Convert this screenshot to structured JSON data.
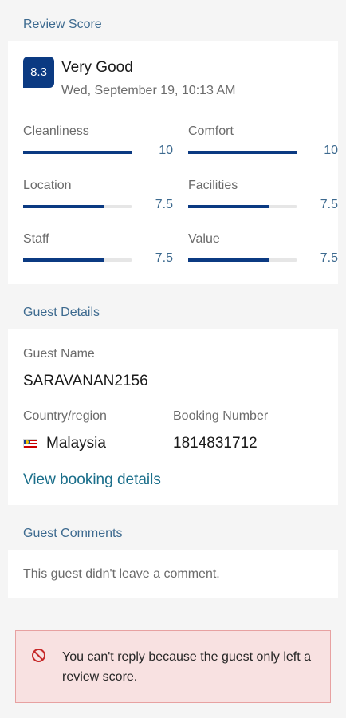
{
  "review_score": {
    "section_title": "Review Score",
    "score": "8.3",
    "rating_label": "Very Good",
    "date": "Wed, September 19, 10:13 AM",
    "metrics": [
      {
        "name": "Cleanliness",
        "value": "10",
        "fraction": 1.0
      },
      {
        "name": "Comfort",
        "value": "10",
        "fraction": 1.0
      },
      {
        "name": "Location",
        "value": "7.5",
        "fraction": 0.75
      },
      {
        "name": "Facilities",
        "value": "7.5",
        "fraction": 0.75
      },
      {
        "name": "Staff",
        "value": "7.5",
        "fraction": 0.75
      },
      {
        "name": "Value",
        "value": "7.5",
        "fraction": 0.75
      }
    ]
  },
  "guest_details": {
    "section_title": "Guest Details",
    "guest_name_label": "Guest Name",
    "guest_name": "SARAVANAN2156",
    "country_label": "Country/region",
    "country": "Malaysia",
    "country_flag_icon": "malaysia-flag-icon",
    "booking_number_label": "Booking Number",
    "booking_number": "1814831712",
    "view_booking_link": "View booking details"
  },
  "guest_comments": {
    "section_title": "Guest Comments",
    "comment_text": "This guest didn't leave a comment."
  },
  "alert": {
    "icon": "prohibited-icon",
    "text": "You can't reply because the guest only left a review score."
  },
  "colors": {
    "accent": "#0b3a82",
    "section_title": "#3d6a8f",
    "link": "#1a6e8a",
    "alert_bg": "#f8e1e1",
    "alert_border": "#e7a1a1",
    "alert_icon": "#c62828"
  }
}
